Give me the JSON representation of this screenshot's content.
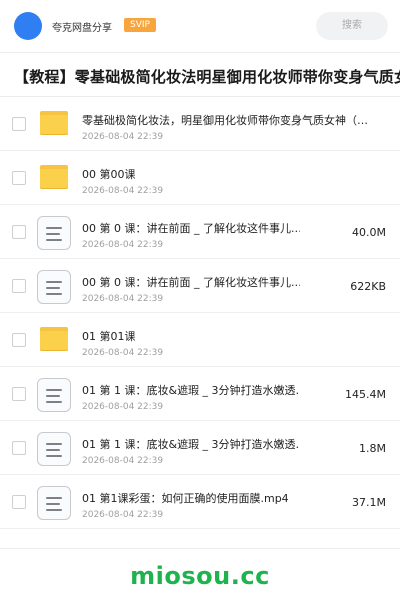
{
  "header": {
    "share_name": "夸克网盘分享",
    "badge": "SVIP",
    "search_placeholder": "搜索",
    "avatar_color": "#2f7ff2",
    "badge_color": "#f7a53c"
  },
  "page_title": "【教程】零基础极简化妆法明星御用化妆师带你变身气质女神",
  "files": [
    {
      "type": "folder",
      "icon": "folder-icon",
      "name": "零基础极简化妆法，明星御用化妆师带你变身气质女神（…",
      "date": "2026-08-04 22:39",
      "size": ""
    },
    {
      "type": "folder",
      "icon": "folder-icon",
      "name": "00 第00课",
      "date": "2026-08-04 22:39",
      "size": ""
    },
    {
      "type": "file",
      "icon": "document-icon",
      "name": "00 第 0 课：讲在前面 _ 了解化妆这件事儿.…",
      "date": "2026-08-04 22:39",
      "size": "40.0M"
    },
    {
      "type": "file",
      "icon": "document-icon",
      "name": "00 第 0 课：讲在前面 _ 了解化妆这件事儿.…",
      "date": "2026-08-04 22:39",
      "size": "622KB"
    },
    {
      "type": "folder",
      "icon": "folder-icon",
      "name": "01 第01课",
      "date": "2026-08-04 22:39",
      "size": ""
    },
    {
      "type": "file",
      "icon": "document-icon",
      "name": "01 第 1 课：底妆&遮瑕 _ 3分钟打造水嫩透…",
      "date": "2026-08-04 22:39",
      "size": "145.4M"
    },
    {
      "type": "file",
      "icon": "document-icon",
      "name": "01 第 1 课：底妆&遮瑕 _ 3分钟打造水嫩透…",
      "date": "2026-08-04 22:39",
      "size": "1.8M"
    },
    {
      "type": "file",
      "icon": "document-icon",
      "name": "01 第1课彩蛋：如何正确的使用面膜.mp4",
      "date": "2026-08-04 22:39",
      "size": "37.1M"
    }
  ],
  "watermark": "miosou.cc",
  "colors": {
    "folder": "#fbd14b",
    "watermark": "#1fb34e"
  }
}
